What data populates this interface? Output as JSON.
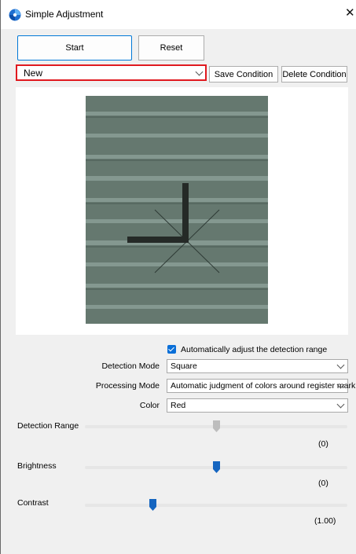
{
  "window": {
    "title": "Simple Adjustment",
    "close_glyph": "✕"
  },
  "toolbar": {
    "start_label": "Start",
    "reset_label": "Reset"
  },
  "condition": {
    "selected": "New",
    "save_label": "Save Condition",
    "delete_label": "Delete Condition"
  },
  "settings": {
    "auto_adjust_label": "Automatically adjust the detection range",
    "auto_adjust_checked": true,
    "detection_mode_label": "Detection Mode",
    "detection_mode_value": "Square",
    "processing_mode_label": "Processing Mode",
    "processing_mode_value": "Automatic judgment of colors around register mark",
    "color_label": "Color",
    "color_value": "Red"
  },
  "sliders": {
    "detection_range": {
      "label": "Detection Range",
      "value_text": "(0)",
      "position": 0.5,
      "enabled": false
    },
    "brightness": {
      "label": "Brightness",
      "value_text": "(0)",
      "position": 0.5,
      "enabled": true
    },
    "contrast": {
      "label": "Contrast",
      "value_text": "(1.00)",
      "position": 0.26,
      "enabled": true
    }
  },
  "colors": {
    "accent": "#0078d7",
    "highlight_border": "#e0191f",
    "slider_thumb": "#1565c0",
    "slider_disabled": "#bdbdbd"
  }
}
